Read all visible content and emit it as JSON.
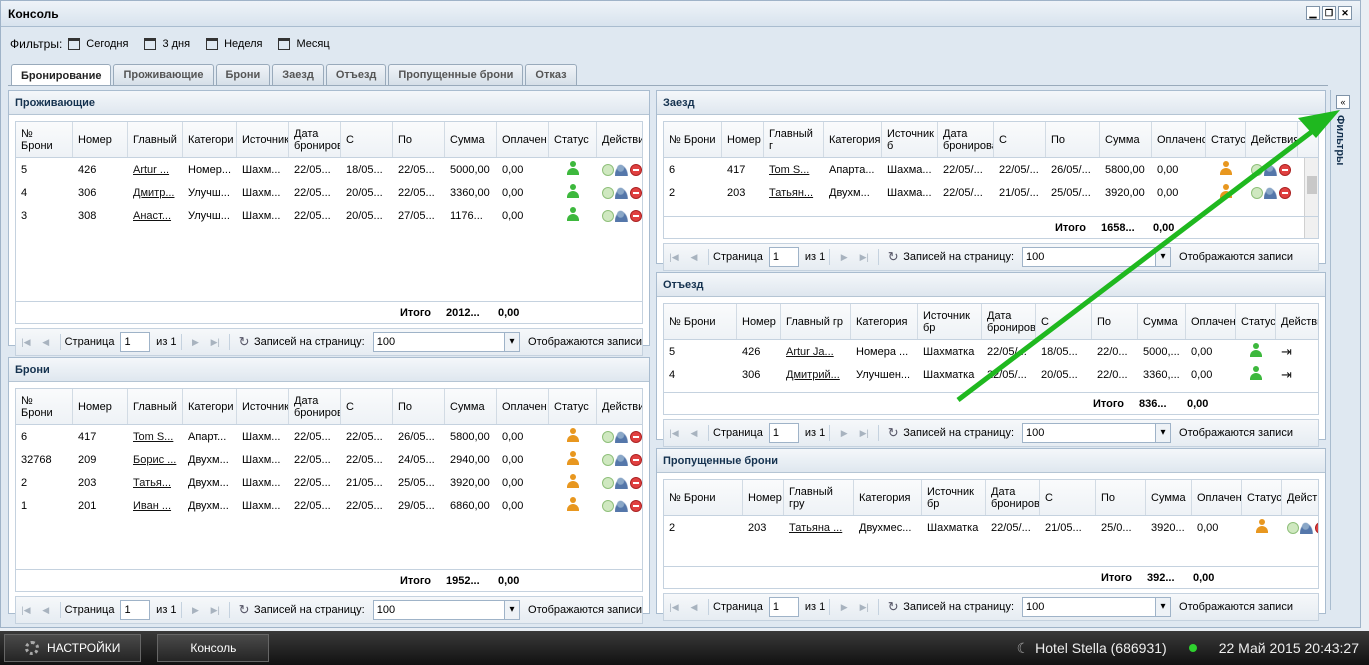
{
  "window": {
    "title": "Консоль"
  },
  "filters": {
    "label": "Фильтры:",
    "buttons": [
      "Сегодня",
      "3 дня",
      "Неделя",
      "Месяц"
    ]
  },
  "tabs": [
    "Бронирование",
    "Проживающие",
    "Брони",
    "Заезд",
    "Отъезд",
    "Пропущенные брони",
    "Отказ"
  ],
  "sidebar": {
    "label": "Фильтры"
  },
  "pager": {
    "page_label": "Страница",
    "page_value": "1",
    "of_label": "из 1",
    "per_page_label": "Записей на страницу:",
    "per_page_value": "100",
    "shown_label": "Отображаются записи"
  },
  "residents": {
    "title": "Проживающие",
    "headers": [
      "№ Брони",
      "Номер",
      "Главный",
      "Категори",
      "Источник",
      "Дата бронирова",
      "С",
      "По",
      "Сумма",
      "Оплачен",
      "Статус",
      "Действи"
    ],
    "rows": [
      [
        "5",
        "426",
        "Artur ...",
        "Номер...",
        "Шахм...",
        "22/05...",
        "18/05...",
        "22/05...",
        "5000,00",
        "0,00"
      ],
      [
        "4",
        "306",
        "Дмитр...",
        "Улучш...",
        "Шахм...",
        "22/05...",
        "20/05...",
        "22/05...",
        "3360,00",
        "0,00"
      ],
      [
        "3",
        "308",
        "Анаст...",
        "Улучш...",
        "Шахм...",
        "22/05...",
        "20/05...",
        "27/05...",
        "1176...",
        "0,00"
      ]
    ],
    "total_label": "Итого",
    "total_sum": "2012...",
    "total_paid": "0,00"
  },
  "bookings": {
    "title": "Брони",
    "headers": [
      "№ Брони",
      "Номер",
      "Главный",
      "Категори",
      "Источник",
      "Дата бронирова",
      "С",
      "По",
      "Сумма",
      "Оплачен",
      "Статус",
      "Действи"
    ],
    "rows": [
      [
        "6",
        "417",
        "Tom S...",
        "Апарт...",
        "Шахм...",
        "22/05...",
        "22/05...",
        "26/05...",
        "5800,00",
        "0,00"
      ],
      [
        "32768",
        "209",
        "Борис ...",
        "Двухм...",
        "Шахм...",
        "22/05...",
        "22/05...",
        "24/05...",
        "2940,00",
        "0,00"
      ],
      [
        "2",
        "203",
        "Татья...",
        "Двухм...",
        "Шахм...",
        "22/05...",
        "21/05...",
        "25/05...",
        "3920,00",
        "0,00"
      ],
      [
        "1",
        "201",
        "Иван ...",
        "Двухм...",
        "Шахм...",
        "22/05...",
        "22/05...",
        "29/05...",
        "6860,00",
        "0,00"
      ]
    ],
    "total_label": "Итого",
    "total_sum": "1952...",
    "total_paid": "0,00"
  },
  "arrivals": {
    "title": "Заезд",
    "headers": [
      "№ Брони",
      "Номер",
      "Главный г",
      "Категория",
      "Источник б",
      "Дата бронирова",
      "С",
      "По",
      "Сумма",
      "Оплачено",
      "Статус",
      "Действия"
    ],
    "rows": [
      [
        "6",
        "417",
        "Tom S...",
        "Апарта...",
        "Шахма...",
        "22/05/...",
        "22/05/...",
        "26/05/...",
        "5800,00",
        "0,00"
      ],
      [
        "2",
        "203",
        "Татьян...",
        "Двухм...",
        "Шахма...",
        "22/05/...",
        "21/05/...",
        "25/05/...",
        "3920,00",
        "0,00"
      ]
    ],
    "total_label": "Итого",
    "total_sum": "1658...",
    "total_paid": "0,00"
  },
  "departures": {
    "title": "Отъезд",
    "headers": [
      "№ Брони",
      "Номер",
      "Главный гр",
      "Категория",
      "Источник бр",
      "Дата бронирова",
      "С",
      "По",
      "Сумма",
      "Оплачен",
      "Статус",
      "Действи"
    ],
    "rows": [
      [
        "5",
        "426",
        "Artur Ja...",
        "Номера ...",
        "Шахматка",
        "22/05/...",
        "18/05...",
        "22/0...",
        "5000,...",
        "0,00"
      ],
      [
        "4",
        "306",
        "Дмитрий...",
        "Улучшен...",
        "Шахматка",
        "22/05/...",
        "20/05...",
        "22/0...",
        "3360,...",
        "0,00"
      ]
    ],
    "total_label": "Итого",
    "total_sum": "836...",
    "total_paid": "0,00"
  },
  "missed": {
    "title": "Пропущенные брони",
    "headers": [
      "№ Брони",
      "Номер",
      "Главный гру",
      "Категория",
      "Источник бр",
      "Дата бронирова",
      "С",
      "По",
      "Сумма",
      "Оплачен",
      "Статус",
      "Действи"
    ],
    "rows": [
      [
        "2",
        "203",
        "Татьяна ...",
        "Двухмес...",
        "Шахматка",
        "22/05/...",
        "21/05...",
        "25/0...",
        "3920...",
        "0,00"
      ]
    ],
    "total_label": "Итого",
    "total_sum": "392...",
    "total_paid": "0,00"
  },
  "taskbar": {
    "settings": "НАСТРОЙКИ",
    "console": "Консоль",
    "hotel": "Hotel Stella (686931)",
    "datetime": "22 Май 2015 20:43:27"
  },
  "colors": {
    "arrow": "#1fb81f",
    "status_green": "#3db83d",
    "status_orange": "#e8971f"
  }
}
